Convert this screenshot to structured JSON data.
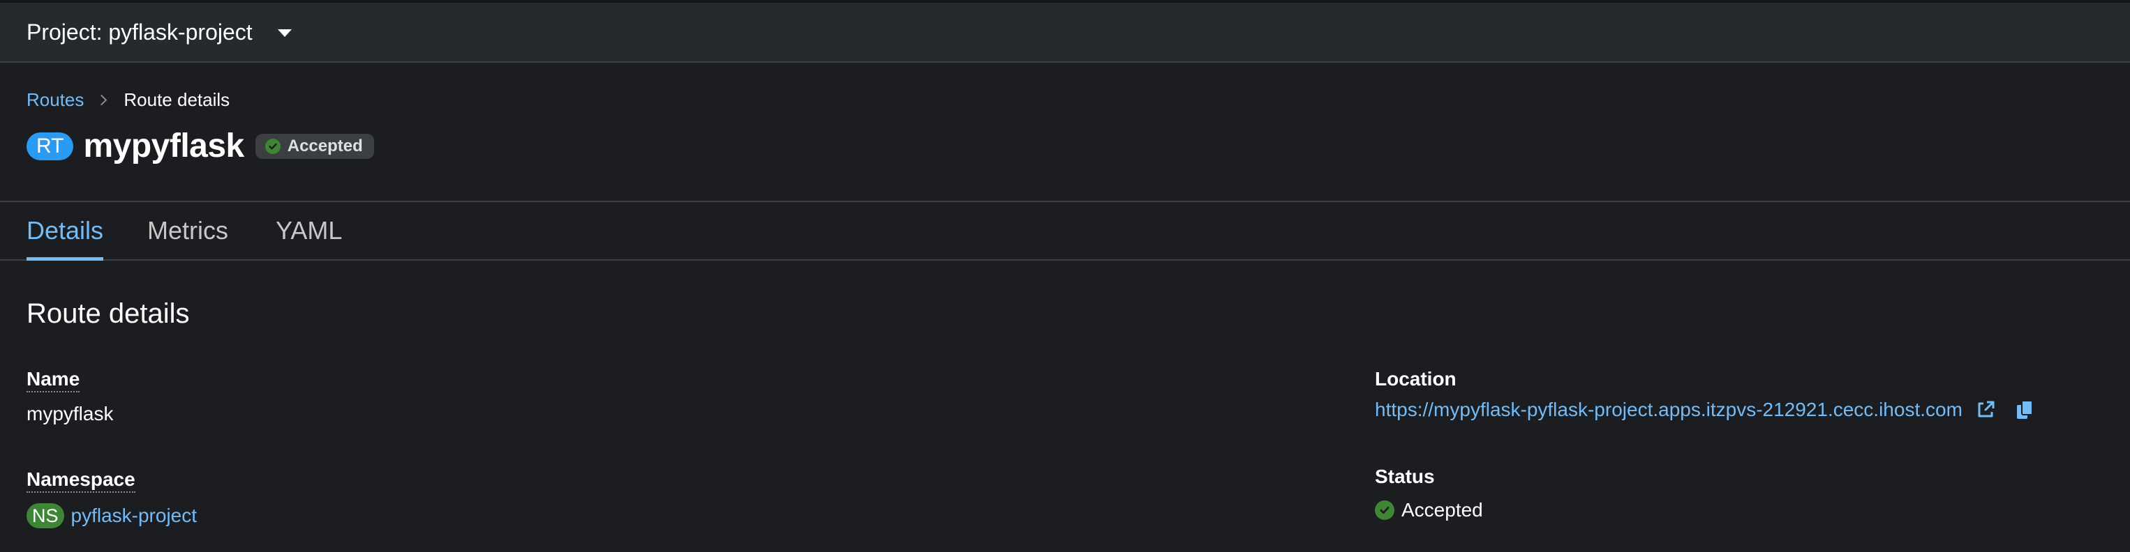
{
  "project_bar": {
    "label": "Project: pyflask-project",
    "dropdown_icon": "caret-down-icon"
  },
  "breadcrumb": {
    "parent": "Routes",
    "current": "Route details"
  },
  "resource": {
    "kind_badge": "RT",
    "kind_badge_color": "#2b9af3",
    "name": "mypyflask",
    "status": "Accepted",
    "status_color": "#3e8635"
  },
  "tabs": [
    {
      "label": "Details",
      "active": true
    },
    {
      "label": "Metrics",
      "active": false
    },
    {
      "label": "YAML",
      "active": false
    }
  ],
  "section": {
    "title": "Route details"
  },
  "fields": {
    "name": {
      "label": "Name",
      "value": "mypyflask"
    },
    "namespace": {
      "label": "Namespace",
      "badge": "NS",
      "badge_color": "#3e8635",
      "value": "pyflask-project"
    },
    "location": {
      "label": "Location",
      "value": "https://mypyflask-pyflask-project.apps.itzpvs-212921.cecc.ihost.com",
      "icons": [
        "external-link-icon",
        "copy-icon"
      ]
    },
    "status": {
      "label": "Status",
      "value": "Accepted"
    }
  },
  "colors": {
    "link": "#73bcf7",
    "background": "#1b1d21",
    "project_bar": "#26292d"
  }
}
